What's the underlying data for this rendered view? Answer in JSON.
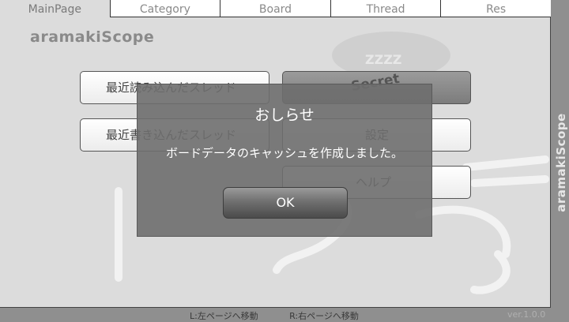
{
  "tabs": [
    {
      "label": "MainPage",
      "active": true
    },
    {
      "label": "Category"
    },
    {
      "label": "Board"
    },
    {
      "label": "Thread"
    },
    {
      "label": "Res"
    }
  ],
  "app_title": "aramakiScope",
  "side_title": "aramakiScope",
  "menu": {
    "recent_read": "最近読み込んだスレッド",
    "recent_write": "最近書き込んだスレッド",
    "secret": "Secret",
    "settings": "設定",
    "help": "ヘルプ"
  },
  "deco_text": "ZZZZ",
  "footer": {
    "left_hint": "L:左ページへ移動",
    "right_hint": "R:右ページへ移動",
    "version": "ver.1.0.0"
  },
  "dialog": {
    "title": "おしらせ",
    "message": "ボードデータのキャッシュを作成しました。",
    "ok_label": "OK"
  }
}
